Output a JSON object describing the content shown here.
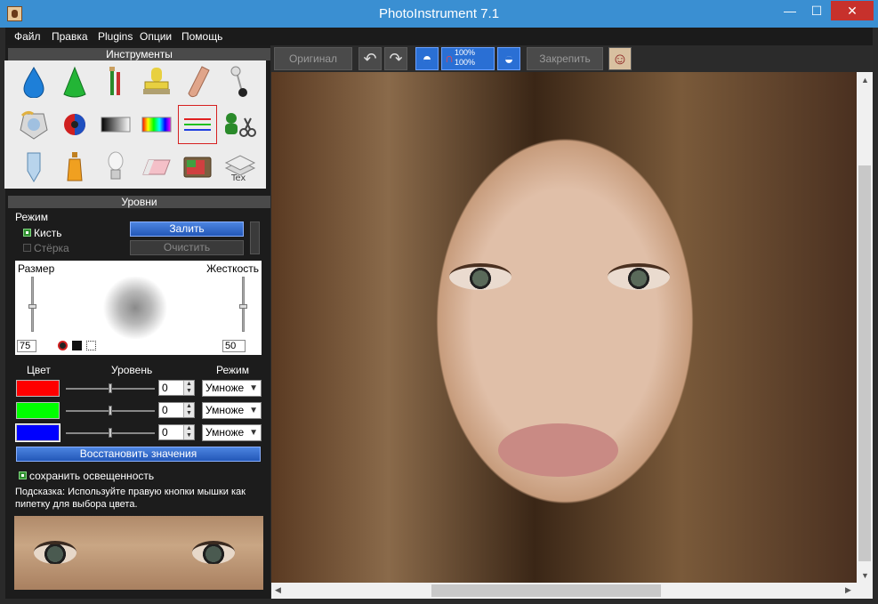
{
  "window": {
    "title": "PhotoInstrument 7.1",
    "min": "—",
    "max": "☐",
    "close": "✕"
  },
  "menu": [
    "Файл",
    "Правка",
    "Plugins",
    "Опции",
    "Помощь"
  ],
  "toolbar": {
    "original": "Оригинал",
    "pin": "Закрепить",
    "zoom_top": "100%",
    "zoom_bottom": "100%"
  },
  "tools_panel": {
    "title": "Инструменты"
  },
  "tools": [
    "drop-tool",
    "cone-tool",
    "brushes-tool",
    "stamp-tool",
    "finger-tool",
    "pin-tool",
    "crystal-tool",
    "color-ball-tool",
    "gradient-tool",
    "spectrum-tool",
    "levels-tool",
    "clone-scissors-tool",
    "tube-tool",
    "bottle-tool",
    "lamp-tool",
    "eraser-tool",
    "tv-tool",
    "text-tool"
  ],
  "levels_panel": {
    "title": "Уровни",
    "mode_label": "Режим",
    "brush": "Кисть",
    "eraser": "Стёрка",
    "fill": "Залить",
    "clear": "Очистить",
    "size_label": "Размер",
    "hardness_label": "Жесткость",
    "size_value": "75",
    "hardness_value": "50",
    "col_color": "Цвет",
    "col_level": "Уровень",
    "col_mode": "Режим",
    "rows": [
      {
        "color": "#ff0000",
        "value": "0",
        "mode": "Умноже",
        "level": 0.5
      },
      {
        "color": "#00ff00",
        "value": "0",
        "mode": "Умноже",
        "level": 0.5
      },
      {
        "color": "#0000ff",
        "value": "0",
        "mode": "Умноже",
        "level": 0.5
      }
    ],
    "restore": "Восстановить значения",
    "keep_light": "сохранить освещенность",
    "hint": "Подсказка: Используйте правую кнопки мышки как пипетку для выбора цвета."
  },
  "accent_color": "#3a8fd2"
}
